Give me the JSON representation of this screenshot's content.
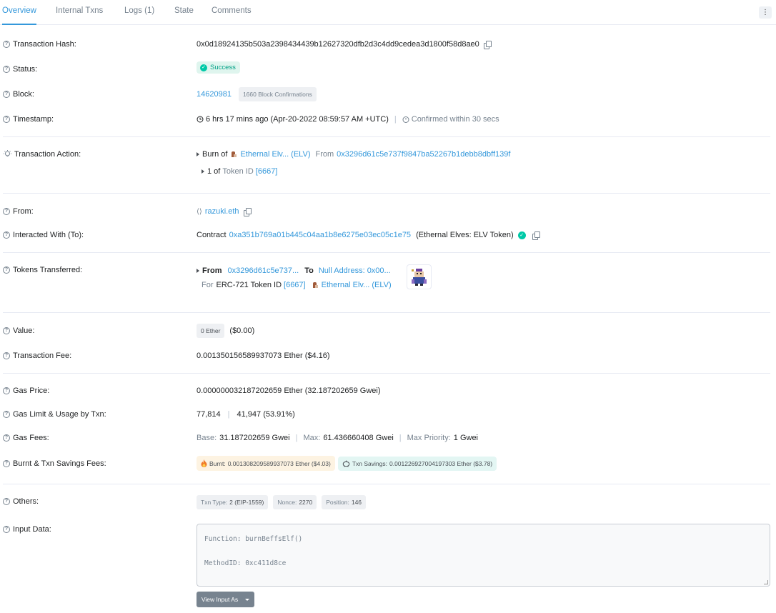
{
  "tabs": [
    {
      "label": "Overview"
    },
    {
      "label": "Internal Txns"
    },
    {
      "label": "Logs (1)"
    },
    {
      "label": "State"
    },
    {
      "label": "Comments"
    }
  ],
  "labels": {
    "tx_hash": "Transaction Hash:",
    "status": "Status:",
    "block": "Block:",
    "timestamp": "Timestamp:",
    "tx_action": "Transaction Action:",
    "from": "From:",
    "interacted": "Interacted With (To):",
    "tokens": "Tokens Transferred:",
    "value": "Value:",
    "tx_fee": "Transaction Fee:",
    "gas_price": "Gas Price:",
    "gas_limit": "Gas Limit & Usage by Txn:",
    "gas_fees": "Gas Fees:",
    "burnt": "Burnt & Txn Savings Fees:",
    "others": "Others:",
    "input": "Input Data:"
  },
  "tx": {
    "hash": "0x0d18924135b503a2398434439b12627320dfb2d3c4dd9cedea3d1800f58d8ae0",
    "status": "Success",
    "block": "14620981",
    "confirmations": "1660 Block Confirmations",
    "timestamp": "6 hrs 17 mins ago (Apr-20-2022 08:59:57 AM +UTC)",
    "confirmed": "Confirmed within 30 secs"
  },
  "action": {
    "burn_of": "Burn of",
    "token_name": "Ethernal Elv... (ELV)",
    "from_label": "From",
    "from_addr": "0x3296d61c5e737f9847ba52267b1debb8dbff139f",
    "count_text": "1 of",
    "token_id_label": "Token ID",
    "token_id": "[6667]"
  },
  "from": {
    "name": "razuki.eth"
  },
  "interacted": {
    "contract_label": "Contract",
    "address": "0xa351b769a01b445c04aa1b8e6275e03ec05c1e75",
    "name": "(Ethernal Elves: ELV Token)"
  },
  "tokens": {
    "from_label": "From",
    "from_addr": "0x3296d61c5e737...",
    "to_label": "To",
    "to_addr": "Null Address: 0x00...",
    "for_label": "For",
    "erc_text": "ERC-721 Token ID",
    "token_id": "[6667]",
    "token_name": "Ethernal Elv... (ELV)"
  },
  "value": {
    "ether": "0 Ether",
    "usd": "($0.00)"
  },
  "tx_fee": "0.001350156589937073 Ether ($4.16)",
  "gas_price": "0.000000032187202659 Ether (32.187202659 Gwei)",
  "gas_limit": {
    "limit": "77,814",
    "usage": "41,947 (53.91%)"
  },
  "gas_fees": {
    "base_label": "Base:",
    "base": "31.187202659 Gwei",
    "max_label": "Max:",
    "max": "61.436660408 Gwei",
    "prio_label": "Max Priority:",
    "prio": "1 Gwei"
  },
  "burnt": {
    "burnt_label": "Burnt:",
    "burnt_value": "0.001308209589937073 Ether ($4.03)",
    "save_label": "Txn Savings:",
    "save_value": "0.001226927004197303 Ether ($3.78)"
  },
  "others": {
    "type_label": "Txn Type:",
    "type_value": "2 (EIP-1559)",
    "nonce_label": "Nonce:",
    "nonce_value": "2270",
    "pos_label": "Position:",
    "pos_value": "146"
  },
  "input": {
    "function": "Function: burnBeffsElf()",
    "method": "MethodID: 0xc411d8ce",
    "button": "View Input As"
  },
  "colors": {
    "accent": "#3498db",
    "success": "#00c9a7",
    "muted": "#77838f"
  }
}
